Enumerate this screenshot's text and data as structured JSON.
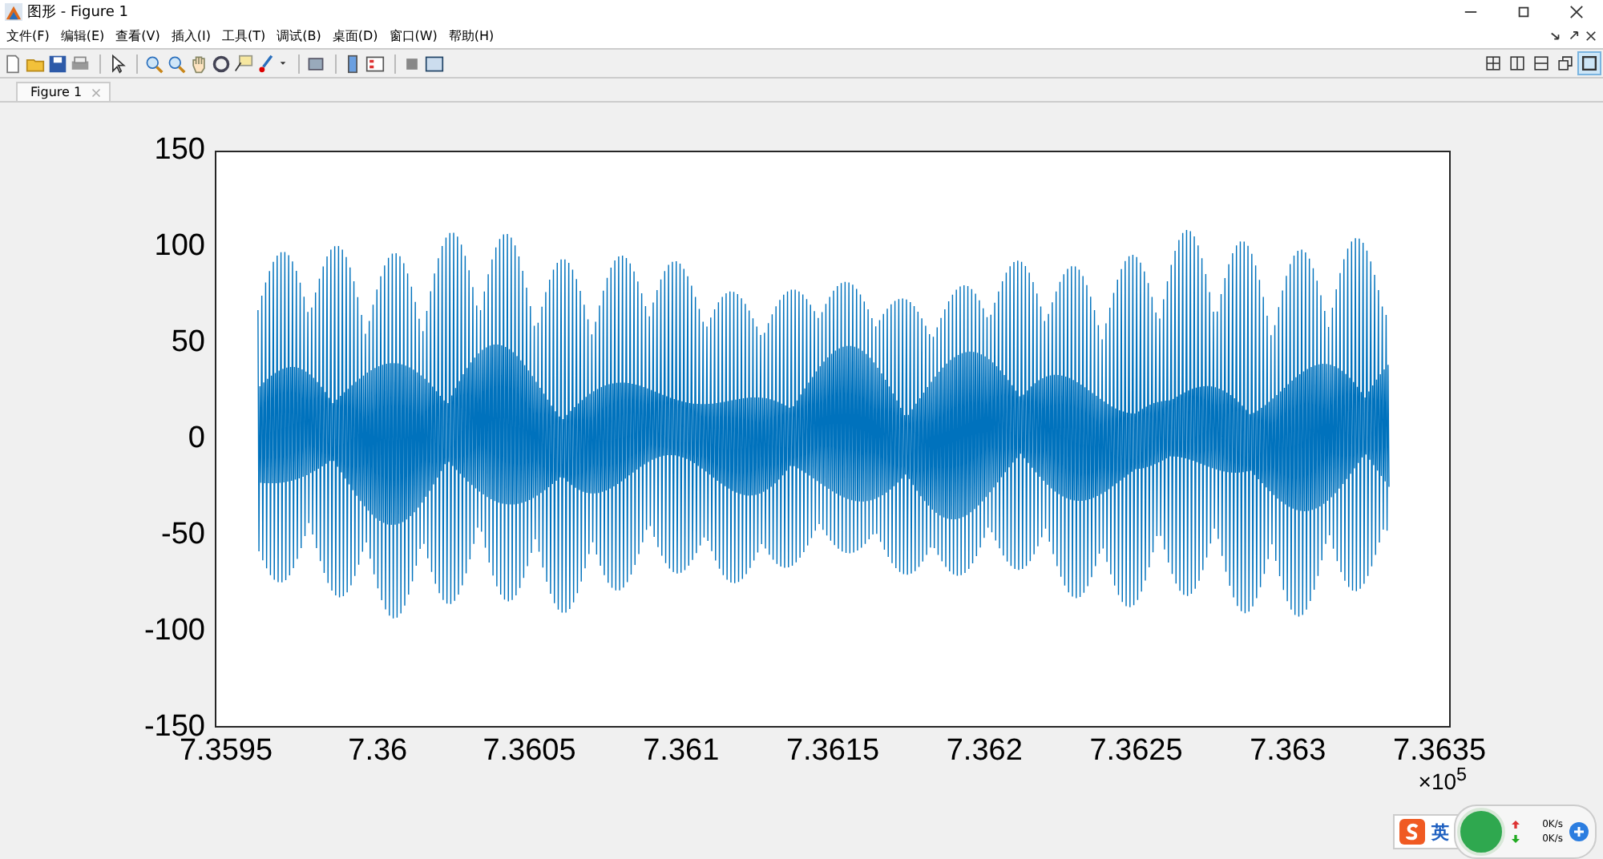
{
  "window": {
    "title": "图形 - Figure 1"
  },
  "menu": [
    "文件(F)",
    "编辑(E)",
    "查看(V)",
    "插入(I)",
    "工具(T)",
    "调试(B)",
    "桌面(D)",
    "窗口(W)",
    "帮助(H)"
  ],
  "layout_buttons": [
    {
      "selected": false
    },
    {
      "selected": false
    },
    {
      "selected": false
    },
    {
      "selected": false
    },
    {
      "selected": true
    }
  ],
  "tabs": [
    {
      "label": "Figure 1",
      "selected": true
    }
  ],
  "plot": {
    "y_ticks": [
      "150",
      "100",
      "50",
      "0",
      "-50",
      "-100",
      "-150"
    ],
    "x_ticks": [
      "7.3595",
      "7.36",
      "7.3605",
      "7.361",
      "7.3615",
      "7.362",
      "7.3625",
      "7.363",
      "7.3635"
    ],
    "x_exponent": "×10$^{5}$"
  },
  "tray": {
    "ime_label": "英",
    "upload_speed": "0K/s",
    "download_speed": "0K/s"
  }
}
